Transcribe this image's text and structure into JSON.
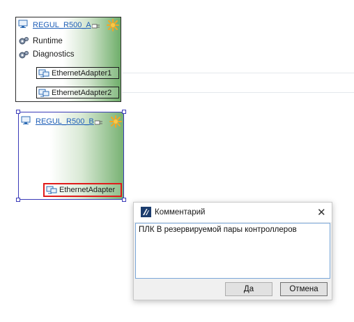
{
  "node_a": {
    "title": "REGUL_R500_A",
    "items": [
      "Runtime",
      "Diagnostics"
    ],
    "adapters": [
      "EthernetAdapter1",
      "EthernetAdapter2"
    ]
  },
  "node_b": {
    "title": "REGUL_R500_B",
    "adapters": [
      "EthernetAdapter"
    ]
  },
  "dialog": {
    "title": "Комментарий",
    "comment_text": "ПЛК В резервируемой пары контроллеров",
    "ok_label": "Да",
    "cancel_label": "Отмена"
  },
  "colors": {
    "link": "#1f5fb8",
    "selection": "#3a3ab8",
    "highlight": "#e01b1b",
    "gradient_green": "#6fae6a",
    "star": "#f5a623"
  },
  "icons": [
    "computer-icon",
    "plug-icon",
    "star-icon",
    "gear-icon",
    "network-adapter-icon",
    "app-logo-icon",
    "close-icon"
  ]
}
